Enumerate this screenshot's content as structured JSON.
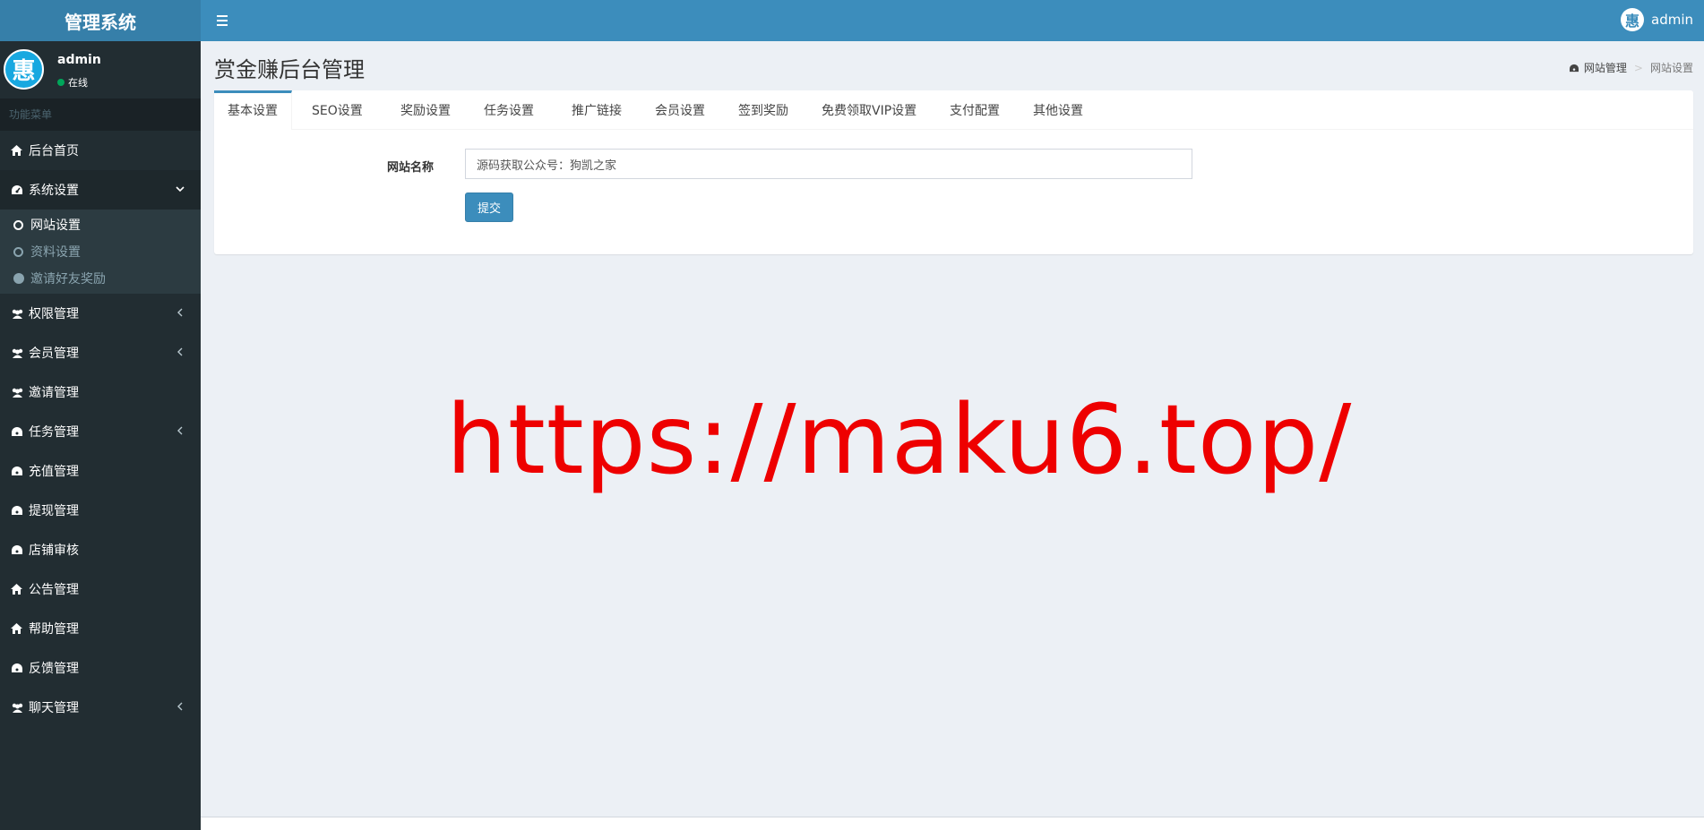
{
  "header": {
    "logo_text": "管理系统",
    "user_name": "admin",
    "avatar_char": "惠"
  },
  "sidebar": {
    "user": {
      "avatar_char": "惠",
      "name": "admin",
      "status": "在线"
    },
    "menu_header": "功能菜单",
    "items": [
      {
        "label": "后台首页",
        "icon": "home-icon"
      },
      {
        "label": "系统设置",
        "icon": "dashboard-icon",
        "expanded": true,
        "children": [
          {
            "label": "网站设置",
            "active": true
          },
          {
            "label": "资料设置"
          },
          {
            "label": "邀请好友奖励"
          }
        ]
      },
      {
        "label": "权限管理",
        "icon": "users-icon"
      },
      {
        "label": "会员管理",
        "icon": "users-icon"
      },
      {
        "label": "邀请管理",
        "icon": "users-icon"
      },
      {
        "label": "任务管理",
        "icon": "dashboard-icon"
      },
      {
        "label": "充值管理",
        "icon": "dashboard-icon"
      },
      {
        "label": "提现管理",
        "icon": "dashboard-icon"
      },
      {
        "label": "店铺审核",
        "icon": "dashboard-icon"
      },
      {
        "label": "公告管理",
        "icon": "home-icon"
      },
      {
        "label": "帮助管理",
        "icon": "home-icon"
      },
      {
        "label": "反馈管理",
        "icon": "dashboard-icon"
      },
      {
        "label": "聊天管理",
        "icon": "users-icon"
      }
    ]
  },
  "page": {
    "title": "赏金赚后台管理",
    "breadcrumb": [
      "网站管理",
      "网站设置"
    ]
  },
  "tabs": [
    "基本设置",
    "SEO设置",
    "奖励设置",
    "任务设置",
    "推广链接",
    "会员设置",
    "签到奖励",
    "免费领取VIP设置",
    "支付配置",
    "其他设置"
  ],
  "form": {
    "site_name_label": "网站名称",
    "site_name_value": "源码获取公众号：狗凯之家",
    "submit_label": "提交"
  },
  "watermark": "https://maku6.top/",
  "colors": {
    "accent": "#3c8dbc",
    "sidebar": "#222d32",
    "watermark": "#ee0000"
  }
}
